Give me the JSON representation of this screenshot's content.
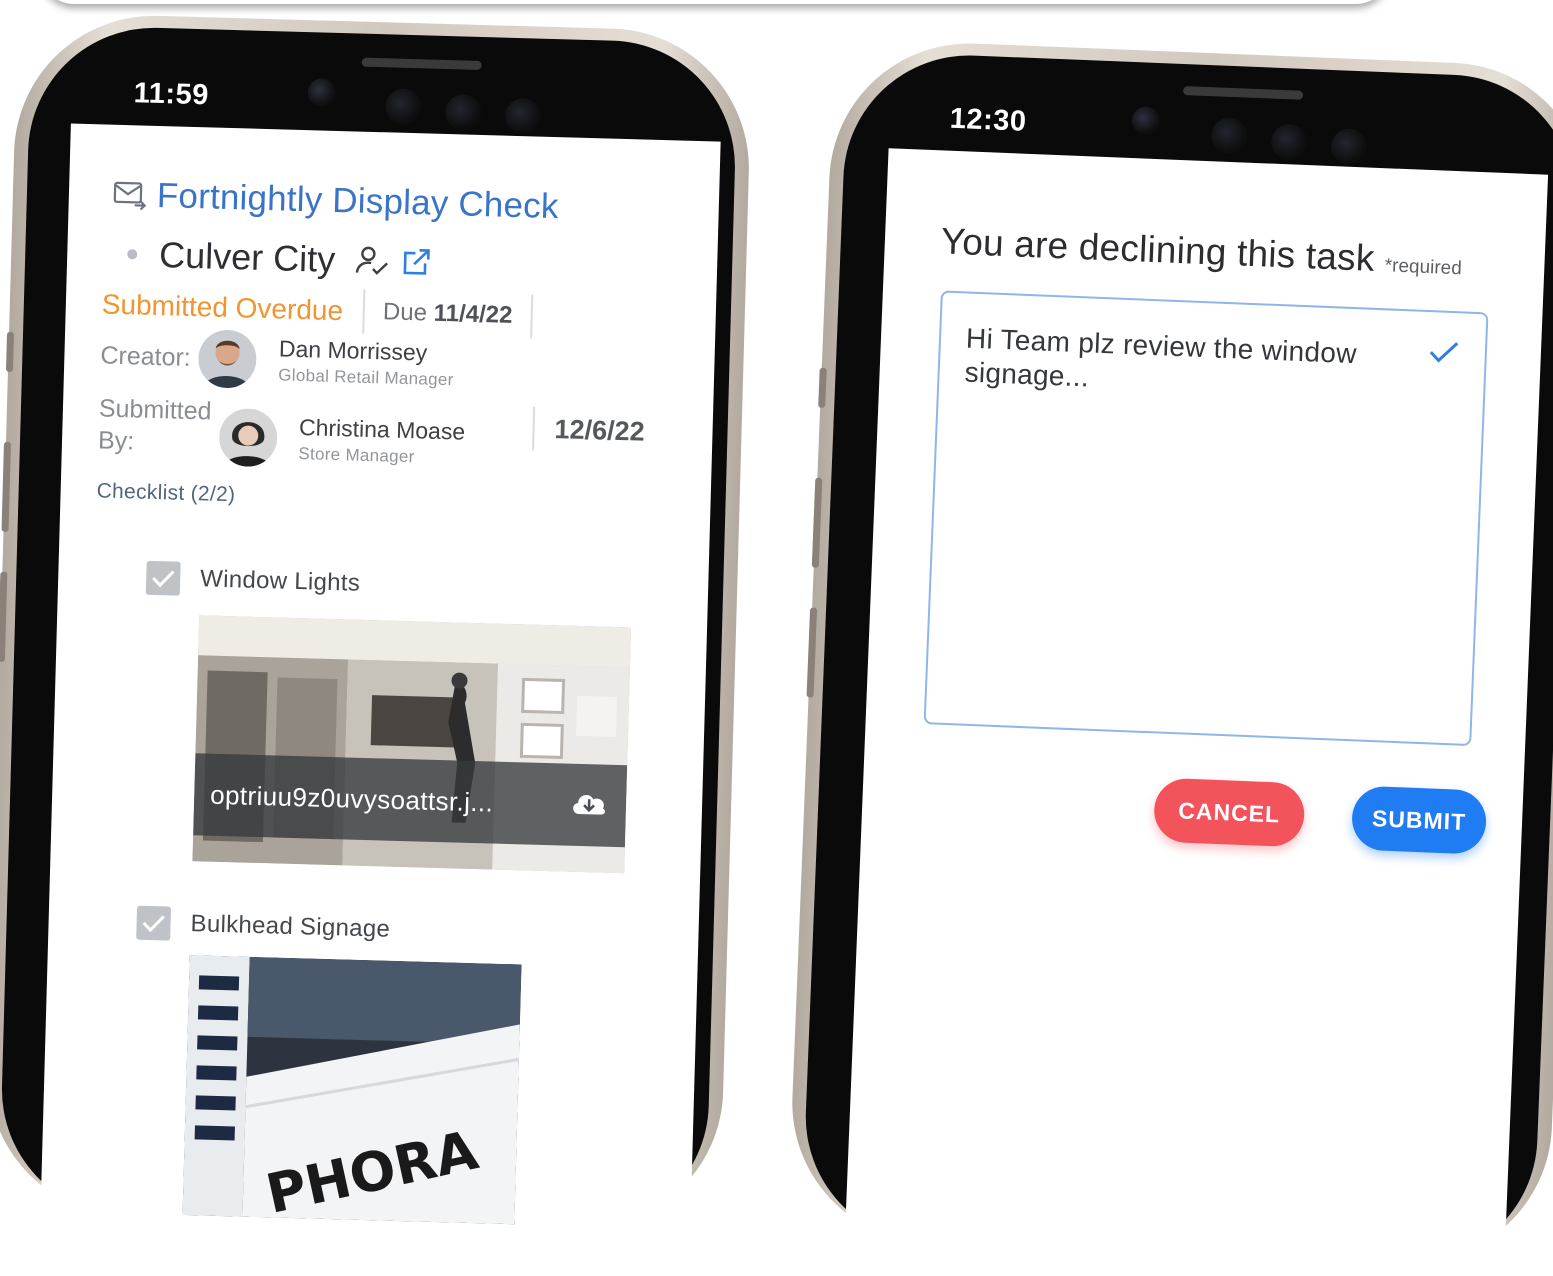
{
  "left_phone": {
    "status_bar": {
      "time": "11:59"
    },
    "task": {
      "title": "Fortnightly Display Check",
      "location": "Culver City",
      "status": "Submitted Overdue",
      "due_label": "Due",
      "due_date": "11/4/22"
    },
    "creator": {
      "label": "Creator:",
      "name": "Dan Morrissey",
      "role": "Global Retail Manager"
    },
    "submitted_by": {
      "label_line1": "Submitted",
      "label_line2": "By:",
      "name": "Christina Moase",
      "role": "Store Manager",
      "date": "12/6/22"
    },
    "checklist": {
      "header": "Checklist (2/2)",
      "items": [
        {
          "label": "Window Lights",
          "checked": true,
          "attachment": "optriuu9z0uvysoattsr.j..."
        },
        {
          "label": "Bulkhead Signage",
          "checked": true,
          "photo_sign_text": "PHORA"
        }
      ]
    },
    "colors": {
      "title_blue": "#3a74c6",
      "overdue_orange": "#f0952f"
    },
    "icons": [
      "mail-send-icon",
      "user-check-icon",
      "external-link-icon",
      "checkbox-checked-icon",
      "cloud-download-icon"
    ]
  },
  "right_phone": {
    "status_bar": {
      "time": "12:30"
    },
    "dialog": {
      "title": "You are declining this task",
      "required_tag": "*required",
      "note_value": "Hi Team plz review the window signage...",
      "cancel_label": "CANCEL",
      "submit_label": "SUBMIT"
    },
    "colors": {
      "cancel_red": "#f3545b",
      "submit_blue": "#1f7cf2",
      "field_border": "#8fb6e7"
    },
    "icons": [
      "check-icon",
      "battery-low-icon"
    ]
  }
}
